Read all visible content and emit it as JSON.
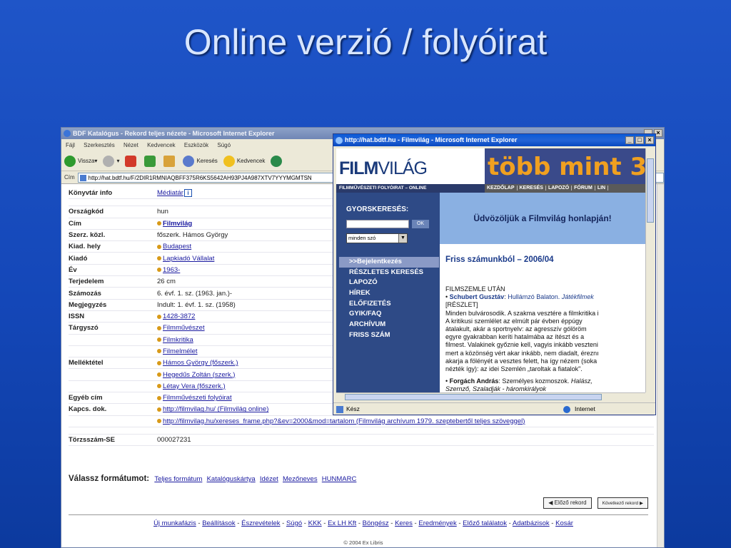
{
  "slide": {
    "title": "Online verzió / folyóirat"
  },
  "catalog_window": {
    "title": "BDF Katalógus - Rekord teljes nézete - Microsoft Internet Explorer",
    "menu": [
      "Fájl",
      "Szerkesztés",
      "Nézet",
      "Kedvencek",
      "Eszközök",
      "Súgó"
    ],
    "toolbar": {
      "back": "Vissza",
      "search": "Keresés",
      "favorites": "Kedvencek"
    },
    "address_label": "Cím",
    "address": "http://hat.bdtf.hu/F/2DIR1RMNIAQBFF375R6KS5642AH93PJ4A987XTV7YYYMGMTSN",
    "record": [
      {
        "label": "Könyvtár info",
        "value": "Médiatár",
        "link": true,
        "info_icon": true
      },
      {
        "label": "",
        "value": "",
        "blank": true
      },
      {
        "label": "Országkód",
        "value": "hun"
      },
      {
        "label": "Cím",
        "value": "Filmvilág",
        "link": true,
        "bold": true,
        "bullet": true
      },
      {
        "label": "Szerz. közl.",
        "value": "főszerk. Hámos György"
      },
      {
        "label": "Kiad. hely",
        "value": "Budapest",
        "link": true,
        "bullet": true
      },
      {
        "label": "Kiadó",
        "value": "Lapkiadó Vállalat",
        "link": true,
        "bullet": true
      },
      {
        "label": "Év",
        "value": "1963-",
        "link": true,
        "bullet": true
      },
      {
        "label": "Terjedelem",
        "value": "26 cm"
      },
      {
        "label": "Számozás",
        "value": "6. évf. 1. sz. (1963. jan.)-"
      },
      {
        "label": "Megjegyzés",
        "value": "Indult: 1. évf. 1. sz. (1958)"
      },
      {
        "label": "ISSN",
        "value": "1428-3872",
        "link": true,
        "bullet": true
      },
      {
        "label": "Tárgyszó",
        "value": "Filmművészet",
        "link": true,
        "bullet": true
      },
      {
        "label": "",
        "value": "Filmkritika",
        "link": true,
        "bullet": true
      },
      {
        "label": "",
        "value": "Filmelmélet",
        "link": true,
        "bullet": true
      },
      {
        "label": "Melléktétel",
        "value": "Hámos György (főszerk.)",
        "link": true,
        "bullet": true
      },
      {
        "label": "",
        "value": "Hegedűs Zoltán (szerk.)",
        "link": true,
        "bullet": true
      },
      {
        "label": "",
        "value": "Létay Vera (főszerk.)",
        "link": true,
        "bullet": true
      },
      {
        "label": "Egyéb cím",
        "value": "Filmművészeti folyóirat",
        "link": true,
        "bullet": true
      },
      {
        "label": "Kapcs. dok.",
        "value": "http://filmvilag.hu/ (Filmvilág online)",
        "link": true,
        "bullet": true
      },
      {
        "label": "",
        "value": "http://filmvilag.hu/xereses_frame.php?&ev=2000&mod=tartalom (Filmvilág archívum 1979. szeptebertől teljes szöveggel)",
        "link": true,
        "bullet": true
      },
      {
        "label": "",
        "value": "",
        "blank": true
      },
      {
        "label": "Törzsszám-SE",
        "value": "000027231"
      }
    ],
    "format_label": "Válassz formátumot:",
    "formats": [
      "Teljes formátum",
      "Katalóguskártya",
      "Idézet",
      "Mezőneves",
      "HUNMARC"
    ],
    "prev_record": "Előző rekord",
    "next_record": "Következő rekord",
    "footer_links": [
      "Új munkafázis",
      "Beállítások",
      "Észrevételek",
      "Súgó",
      "KKK",
      "Ex LH Kft",
      "Böngész",
      "Keres",
      "Eredmények",
      "Előző találatok",
      "Adatbázisok",
      "Kosár"
    ],
    "copyright": "© 2004 Ex Libris"
  },
  "filmvilag_window": {
    "title": "http://hat.bdtf.hu - Filmvilág - Microsoft Internet Explorer",
    "logo_bold": "FILM",
    "logo_rest": "VILÁG",
    "banner": "több mint 3",
    "subtitle": "FILMMŰVÉSZETI FOLYÓIRAT – ONLINE",
    "nav": [
      "KEZDŐLAP",
      "KERESÉS",
      "LAPOZÓ",
      "FÓRUM",
      "LIN"
    ],
    "quick_search": "GYORSKERESÉS:",
    "ok": "OK",
    "select_value": "minden szó",
    "side_menu": [
      ">>Bejelentkezés",
      "RÉSZLETES KERESÉS",
      "LAPOZÓ",
      "HÍREK",
      "ELŐFIZETÉS",
      "GYIK/FAQ",
      "ARCHÍVUM",
      "FRISS SZÁM"
    ],
    "welcome": "Üdvözöljük a Filmvilág honlapján!",
    "issue_heading": "Friss számunkból – 2006/04",
    "text": {
      "l1": "FILMSZEMLE UTÁN",
      "a1": "Schubert Gusztáv",
      "t1": "Hullámzó Balaton.",
      "t1i": "Játékfilmek",
      "l3": "[RÉSZLET]",
      "p1": "Minden bulvárosodik. A szakma vesztére a filmkritika i",
      "p2": "A kritikusi szemlélet az elmúlt pár évben éppúgy",
      "p3": "átalakult, akár a sportnyelv: az agresszív gólöröm",
      "p4": "egyre gyakrabban keríti hatalmába az ítészt és a",
      "p5": "filmest. Valakinek győznie kell, vagyis inkább veszteni",
      "p6": "mert a közönség vért akar inkább, nem diadalt, éreznı",
      "p7": "akarja a fölényét a vesztes felett, ha így nézem (soka",
      "p8": "nézték így): az idei Szemlén „taroltak a fiatalok\".",
      "a2": "Forgách András",
      "t2": "Személyes kozmoszok.",
      "t2i": "Halász,",
      "l13": "Szernző, Szaladják - háromkirályok"
    },
    "status": "Kész",
    "zone": "Internet"
  }
}
